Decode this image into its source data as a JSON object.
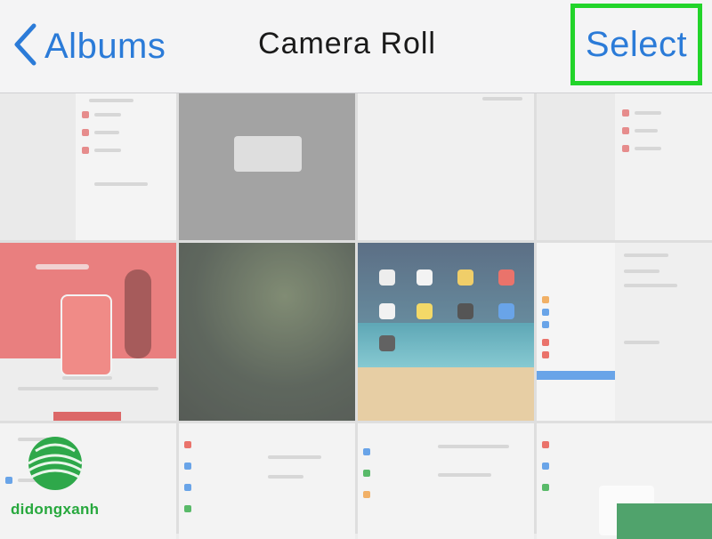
{
  "navbar": {
    "back_label": "Albums",
    "title": "Camera Roll",
    "select_label": "Select"
  },
  "colors": {
    "accent": "#2b7bd8",
    "highlight": "#22d42a",
    "watermark": "#27a83d"
  },
  "icons": {
    "back": "chevron-left-icon"
  },
  "watermark": {
    "text": "didongxanh"
  },
  "grid": {
    "photos": [
      {
        "name": "photo-settings-screenshot-1"
      },
      {
        "name": "photo-delete-dialog-screenshot"
      },
      {
        "name": "photo-blank-screenshot"
      },
      {
        "name": "photo-settings-screenshot-2"
      },
      {
        "name": "photo-red-illustration"
      },
      {
        "name": "photo-blurred-homescreen"
      },
      {
        "name": "photo-ipad-homescreen"
      },
      {
        "name": "photo-settings-general"
      },
      {
        "name": "photo-settings-sidebar-1"
      },
      {
        "name": "photo-settings-sidebar-2"
      },
      {
        "name": "photo-settings-sidebar-3"
      },
      {
        "name": "photo-settings-apple-id"
      }
    ]
  }
}
